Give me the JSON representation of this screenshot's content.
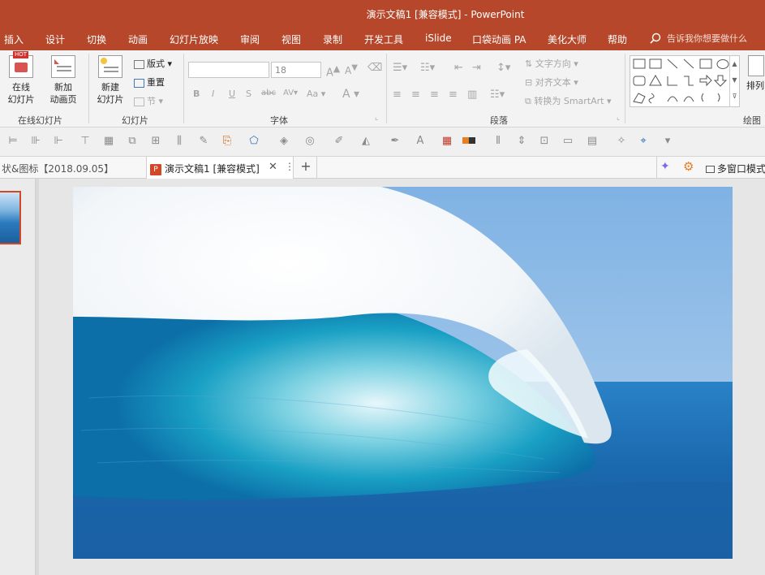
{
  "window": {
    "title": "演示文稿1 [兼容模式]  -  PowerPoint"
  },
  "menu": {
    "items": [
      "插入",
      "设计",
      "切换",
      "动画",
      "幻灯片放映",
      "审阅",
      "视图",
      "录制",
      "开发工具",
      "iSlide",
      "口袋动画 PA",
      "美化大师",
      "帮助"
    ],
    "tell_me": "告诉我你想要做什么"
  },
  "ribbon": {
    "online": {
      "hot_badge": "HOT",
      "btn1": "在线",
      "btn1b": "幻灯片",
      "btn2": "新加",
      "btn2b": "动画页",
      "group": "在线幻灯片"
    },
    "slides": {
      "new1": "新建",
      "new2": "幻灯片",
      "layout": "版式",
      "reset": "重置",
      "section": "节",
      "group": "幻灯片"
    },
    "font": {
      "font_size": "18",
      "group": "字体",
      "aa": "Aa",
      "a": "A"
    },
    "paragraph": {
      "text_dir": "文字方向",
      "align_text": "对齐文本",
      "smartart": "转换为 SmartArt",
      "group": "段落"
    },
    "drawing": {
      "arrange": "排列",
      "group": "绘图"
    }
  },
  "tabs": {
    "prev": "状&图标【2018.09.05】",
    "active": "演示文稿1 [兼容模式]",
    "multiwin": "多窗口模式"
  },
  "colors": {
    "accent": "#b7472a",
    "ribbon_bg": "#f3f3f3"
  }
}
